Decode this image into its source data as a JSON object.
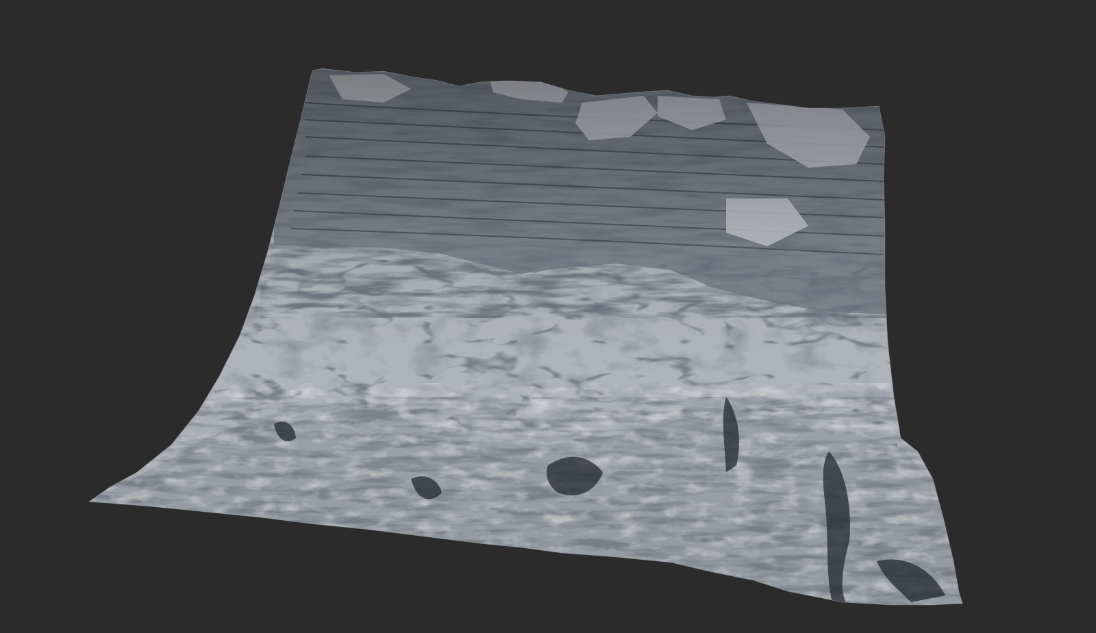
{
  "scene": {
    "background_color": "#2b2b2b",
    "subject": "terrain-heightmap-render",
    "material_colors": {
      "base": "#a9adb5",
      "highlight": "#d6d8dc",
      "shadow": "#2e333c",
      "sediment": "#c9c3b6"
    }
  }
}
